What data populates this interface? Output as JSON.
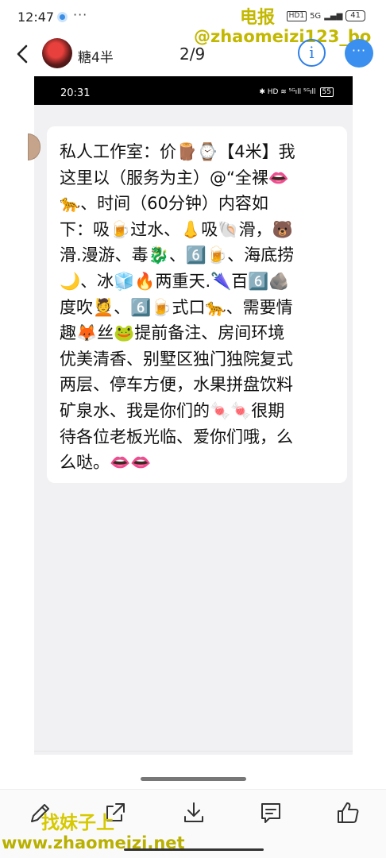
{
  "status_bar": {
    "time": "12:47",
    "more": "···",
    "net_label": "HD1",
    "signal": "5G",
    "battery": "41"
  },
  "watermark": {
    "top_title": "电报",
    "top_url": "@zhaomeizi123_bo",
    "bottom_title": "找妹子上",
    "bottom_url": "www.zhaomeizi.net"
  },
  "header": {
    "user_name": "糖4半",
    "page_indicator": "2/9",
    "info_icon": "i",
    "more_icon": "···"
  },
  "inner_screenshot": {
    "time": "20:31",
    "status_icons": "✱ HD ≋ ⁵ᴳıll ⁵ᴳıll",
    "battery": "55",
    "message_lines": [
      "私人工作室：价🪵⌚【4米】我",
      "这里以（服务为主）@“全裸👄",
      "🐆、时间（60分钟）内容如",
      "下：吸🍺过水、👃吸🐚滑，🐻",
      "滑.漫游、毒🐉、6️⃣🍺、海底捞",
      "🌙、冰🧊🔥两重天.🌂百6️⃣🪨",
      "度吹💆、6️⃣🍺式口🐆、需要情",
      "趣🦊丝🐸提前备注、房间环境",
      "优美清香、别墅区独门独院复式",
      "两层、停车方便，水果拼盘饮料",
      "矿泉水、我是你们的🍬🍬很期",
      "待各位老板光临、爱你们哦，么",
      "么哒。👄👄"
    ]
  },
  "toolbar": {
    "items": [
      "edit-icon",
      "share-icon",
      "download-icon",
      "comment-icon",
      "like-icon"
    ]
  }
}
